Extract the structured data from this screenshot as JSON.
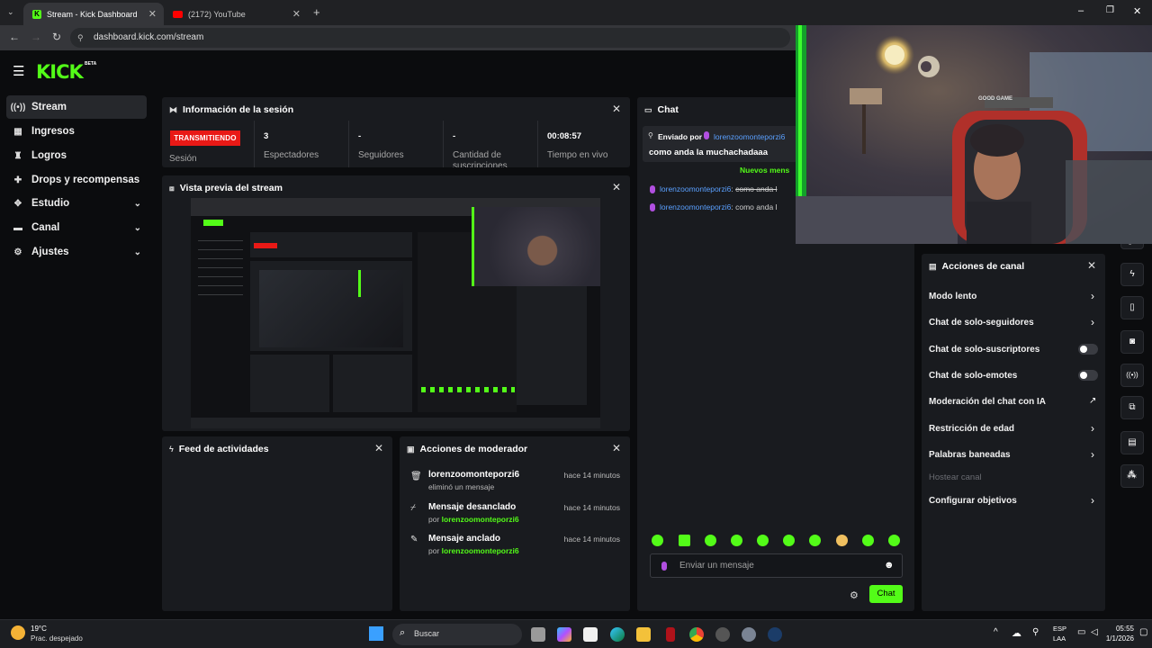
{
  "browser": {
    "tabs": [
      {
        "title": "Stream - Kick Dashboard",
        "active": true
      },
      {
        "title": "(2172) YouTube",
        "active": false
      }
    ],
    "url": "dashboard.kick.com/stream"
  },
  "brand": {
    "logo": "KICK",
    "beta": "BETA",
    "accent": "#53fc18"
  },
  "sidebar": {
    "items": [
      {
        "label": "Stream",
        "icon": "stream-icon",
        "active": true,
        "expandable": false
      },
      {
        "label": "Ingresos",
        "icon": "revenue-icon",
        "active": false,
        "expandable": false
      },
      {
        "label": "Logros",
        "icon": "trophy-icon",
        "active": false,
        "expandable": false
      },
      {
        "label": "Drops y recompensas",
        "icon": "gift-icon",
        "active": false,
        "expandable": false
      },
      {
        "label": "Estudio",
        "icon": "studio-icon",
        "active": false,
        "expandable": true
      },
      {
        "label": "Canal",
        "icon": "channel-icon",
        "active": false,
        "expandable": true
      },
      {
        "label": "Ajustes",
        "icon": "gear-icon",
        "active": false,
        "expandable": true
      }
    ]
  },
  "session": {
    "title": "Información de la sesión",
    "status_badge": "TRANSMITIENDO",
    "status_label": "Sesión",
    "stats": [
      {
        "value": "3",
        "label": "Espectadores"
      },
      {
        "value": "-",
        "label": "Seguidores"
      },
      {
        "value": "-",
        "label": "Cantidad de suscripciones"
      },
      {
        "value": "00:08:57",
        "label": "Tiempo en vivo"
      }
    ]
  },
  "preview": {
    "title": "Vista previa del stream"
  },
  "activity": {
    "title": "Feed de actividades"
  },
  "mod_actions": {
    "title": "Acciones de moderador",
    "items": [
      {
        "title": "lorenzoomonteporzi6",
        "sub": "eliminó un mensaje",
        "sub_user": "",
        "time": "hace 14 minutos",
        "icon": "trash-icon"
      },
      {
        "title": "Mensaje desanclado",
        "sub": "por",
        "sub_user": "lorenzoomonteporzi6",
        "time": "hace 14 minutos",
        "icon": "unpin-icon"
      },
      {
        "title": "Mensaje anclado",
        "sub": "por",
        "sub_user": "lorenzoomonteporzi6",
        "time": "hace 14 minutos",
        "icon": "pin-icon"
      }
    ]
  },
  "chat": {
    "title": "Chat",
    "pinned_prefix": "Enviado por",
    "pinned_user": "lorenzoomonteporzi6",
    "pinned_message": "como anda la muchachadaaa",
    "new_followers": "Nuevos mens",
    "messages": [
      {
        "user": "lorenzoomonteporzi6",
        "text": "como anda l",
        "struck": true
      },
      {
        "user": "lorenzoomonteporzi6",
        "text": "como anda l",
        "struck": false
      }
    ],
    "input_placeholder": "Enviar un mensaje",
    "send_label": "Chat"
  },
  "channel_actions": {
    "title": "Acciones de canal",
    "items": [
      {
        "label": "Modo lento",
        "control": "chevron"
      },
      {
        "label": "Chat de solo-seguidores",
        "control": "chevron"
      },
      {
        "label": "Chat de solo-suscriptores",
        "control": "toggle"
      },
      {
        "label": "Chat de solo-emotes",
        "control": "toggle"
      },
      {
        "label": "Moderación del chat con IA",
        "control": "external"
      },
      {
        "label": "Restricción de edad",
        "control": "chevron"
      },
      {
        "label": "Palabras baneadas",
        "control": "chevron"
      },
      {
        "label": "Hostear canal",
        "control": "disabled"
      },
      {
        "label": "Configurar objetivos",
        "control": "chevron"
      }
    ]
  },
  "taskbar": {
    "weather_temp": "19°C",
    "weather_desc": "Prac. despejado",
    "search_placeholder": "Buscar",
    "lang_line1": "ESP",
    "lang_line2": "LAA",
    "time": "05:55",
    "date": "1/1/2026"
  },
  "webcam_overlay": {
    "sign": "GOOD GAME"
  }
}
